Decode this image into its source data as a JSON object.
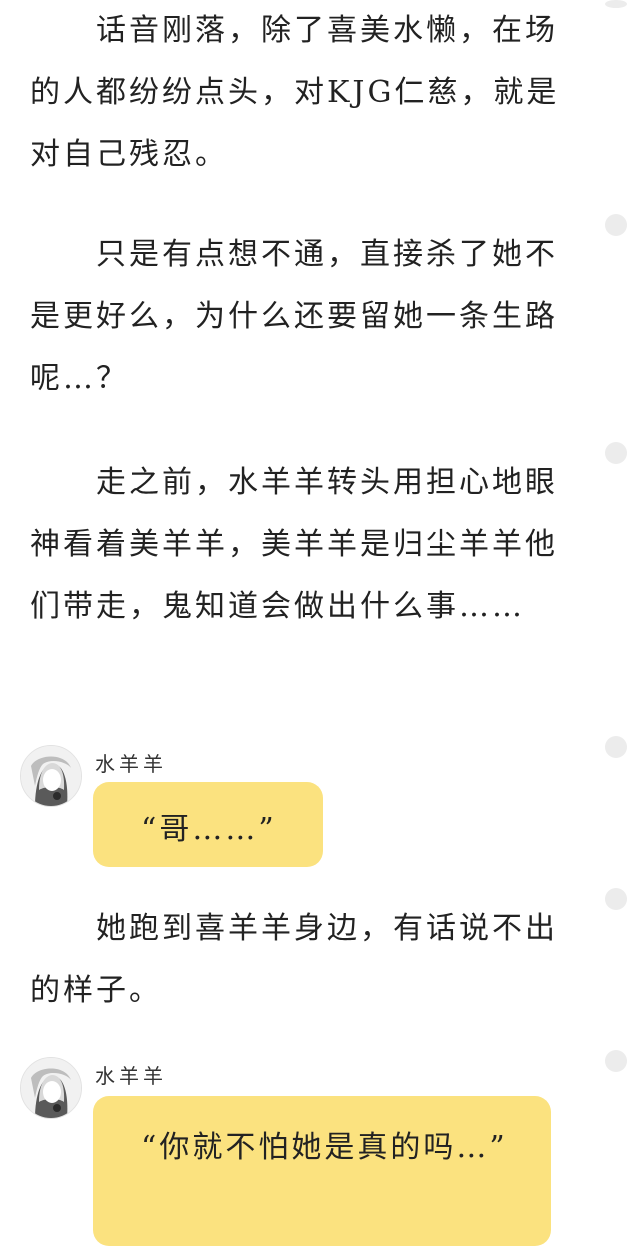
{
  "story": {
    "para1": "　　话音刚落，除了喜美水懒，在场的人都纷纷点头，对KJG仁慈，就是对自己残忍。",
    "para2": "　　只是有点想不通，直接杀了她不是更好么，为什么还要留她一条生路呢…？",
    "para3": "　　走之前，水羊羊转头用担心地眼神看着美羊羊，美羊羊是归尘羊羊他们带走，鬼知道会做出什么事……",
    "para4": "　　她跑到喜羊羊身边，有话说不出的样子。"
  },
  "chat": [
    {
      "speaker": "水羊羊",
      "text": "“哥……”"
    },
    {
      "speaker": "水羊羊",
      "text": "“你就不怕她是真的吗…”"
    }
  ],
  "colors": {
    "bubble": "#fbe27f",
    "dot": "#ececec"
  },
  "icons": {
    "comment_marker": "comment-dot-icon",
    "avatar": "anime-character-avatar"
  }
}
